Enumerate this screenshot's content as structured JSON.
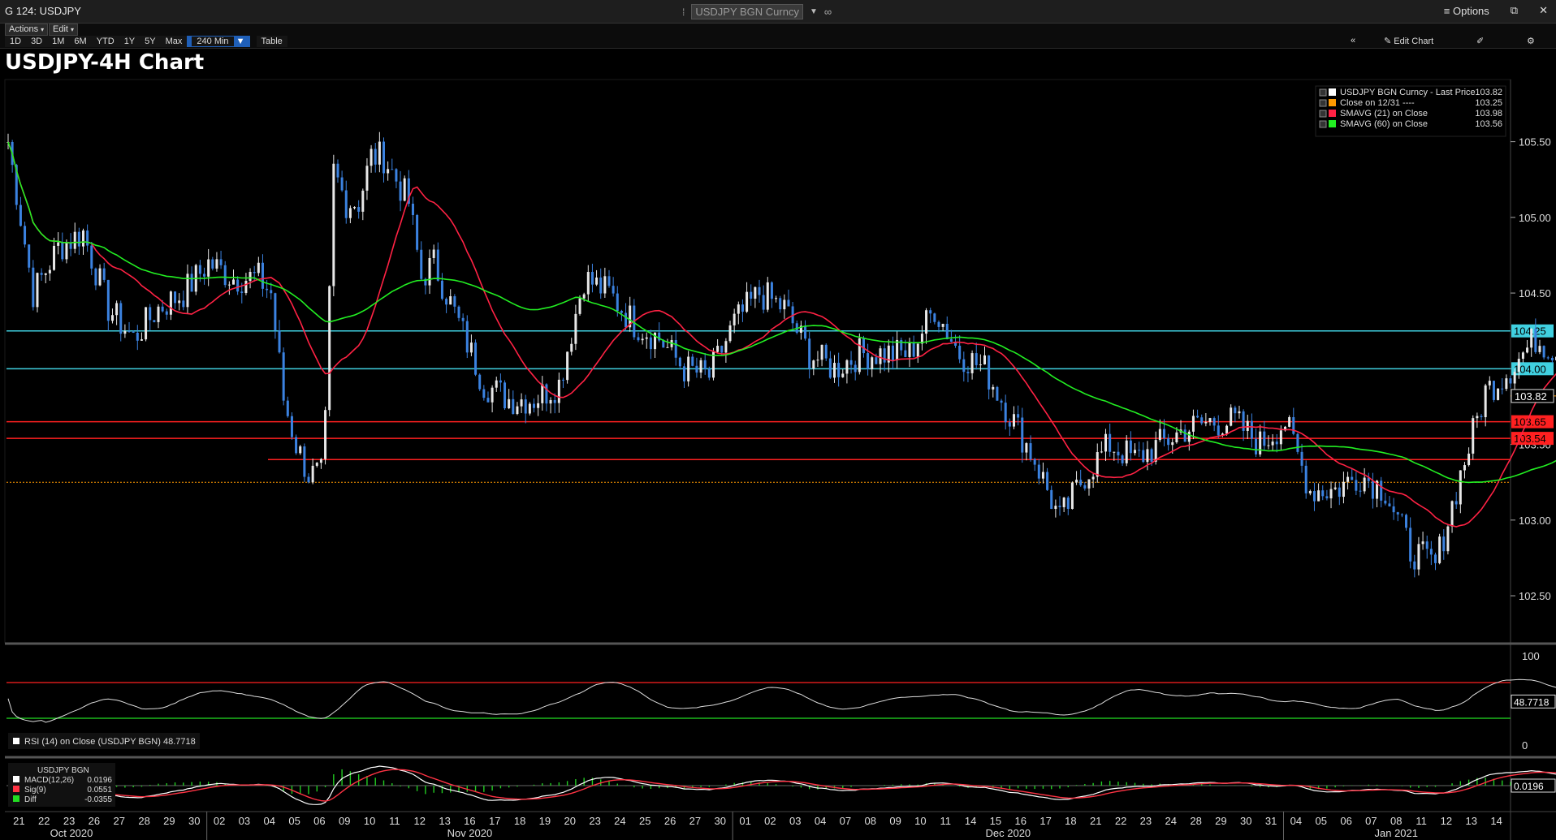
{
  "window": {
    "title": "G 124: USDJPY",
    "security": "USDJPY BGN Curncy",
    "options_label": "Options"
  },
  "toolbar": {
    "actions_label": "Actions",
    "edit_label": "Edit",
    "ranges": [
      "1D",
      "3D",
      "1M",
      "6M",
      "YTD",
      "1Y",
      "5Y",
      "Max",
      "240 Min"
    ],
    "selected_range": "240 Min",
    "table_label": "Table",
    "edit_chart_label": "Edit Chart"
  },
  "chart_title": "USDJPY-4H Chart",
  "legend": [
    {
      "label": "USDJPY BGN Curncy - Last Price",
      "value": "103.82",
      "color": "#ffffff"
    },
    {
      "label": "Close on 12/31 ----",
      "value": "103.25",
      "color": "#ff9900"
    },
    {
      "label": "SMAVG (21)  on Close",
      "value": "103.98",
      "color": "#ff2244"
    },
    {
      "label": "SMAVG (60)  on Close",
      "value": "103.56",
      "color": "#22ee22"
    }
  ],
  "chart_data": {
    "type": "candlestick",
    "ylim": [
      102.2,
      105.9
    ],
    "yticks": [
      "105.50",
      "105.00",
      "104.50",
      "104.00",
      "103.50",
      "103.00",
      "102.50"
    ],
    "x_days": [
      "21",
      "22",
      "23",
      "26",
      "27",
      "28",
      "29",
      "30",
      "02",
      "03",
      "04",
      "05",
      "06",
      "09",
      "10",
      "11",
      "12",
      "13",
      "16",
      "17",
      "18",
      "19",
      "20",
      "23",
      "24",
      "25",
      "26",
      "27",
      "30",
      "01",
      "02",
      "03",
      "04",
      "07",
      "08",
      "09",
      "10",
      "11",
      "14",
      "15",
      "16",
      "17",
      "18",
      "21",
      "22",
      "23",
      "24",
      "28",
      "29",
      "30",
      "31",
      "04",
      "05",
      "06",
      "07",
      "08",
      "11",
      "12",
      "13",
      "14"
    ],
    "months": [
      {
        "label": "Oct 2020",
        "first_day_index": 0
      },
      {
        "label": "Nov 2020",
        "first_day_index": 8
      },
      {
        "label": "Dec 2020",
        "first_day_index": 29
      },
      {
        "label": "Jan 2021",
        "first_day_index": 51
      }
    ],
    "levels": [
      {
        "value": 104.25,
        "label": "104.25",
        "color": "#40d0e0"
      },
      {
        "value": 104.0,
        "label": "104.00",
        "color": "#40d0e0"
      },
      {
        "value": 103.65,
        "label": "103.65",
        "color": "#ff2020"
      },
      {
        "value": 103.54,
        "label": "103.54",
        "color": "#ff2020"
      },
      {
        "value": 103.4,
        "label": "",
        "color": "#ff2020"
      }
    ],
    "last_price": {
      "value": 103.82,
      "label": "103.82"
    },
    "close_1231": 103.25,
    "price_anchors": [
      [
        0,
        105.5
      ],
      [
        1,
        104.5
      ],
      [
        2,
        104.8
      ],
      [
        3,
        104.9
      ],
      [
        4,
        104.4
      ],
      [
        5,
        104.2
      ],
      [
        6,
        104.4
      ],
      [
        7,
        104.5
      ],
      [
        8,
        104.7
      ],
      [
        9,
        104.6
      ],
      [
        10,
        104.6
      ],
      [
        10.5,
        104.5
      ],
      [
        11,
        103.8
      ],
      [
        11.5,
        103.5
      ],
      [
        12,
        103.3
      ],
      [
        12.6,
        103.3
      ],
      [
        13,
        105.3
      ],
      [
        13.5,
        105.1
      ],
      [
        14,
        105.1
      ],
      [
        14.5,
        105.4
      ],
      [
        15,
        105.4
      ],
      [
        16,
        105.1
      ],
      [
        16.5,
        104.6
      ],
      [
        17,
        104.7
      ],
      [
        18,
        104.3
      ],
      [
        19,
        103.9
      ],
      [
        20,
        103.8
      ],
      [
        21,
        103.8
      ],
      [
        22,
        103.9
      ],
      [
        23,
        104.6
      ],
      [
        24,
        104.5
      ],
      [
        25,
        104.3
      ],
      [
        26,
        104.2
      ],
      [
        27,
        104.0
      ],
      [
        28,
        103.95
      ],
      [
        29,
        104.3
      ],
      [
        30,
        104.5
      ],
      [
        31,
        104.4
      ],
      [
        32,
        104.1
      ],
      [
        33,
        104.0
      ],
      [
        34,
        104.1
      ],
      [
        35,
        104.1
      ],
      [
        36,
        104.1
      ],
      [
        37,
        104.4
      ],
      [
        38,
        104.1
      ],
      [
        39,
        104.0
      ],
      [
        40,
        103.7
      ],
      [
        41,
        103.4
      ],
      [
        42,
        103.0
      ],
      [
        43,
        103.3
      ],
      [
        44,
        103.5
      ],
      [
        45,
        103.4
      ],
      [
        46,
        103.5
      ],
      [
        47,
        103.6
      ],
      [
        48,
        103.65
      ],
      [
        49,
        103.65
      ],
      [
        50,
        103.5
      ],
      [
        51,
        103.65
      ],
      [
        52,
        103.2
      ],
      [
        53,
        103.2
      ],
      [
        54,
        103.3
      ],
      [
        55,
        103.2
      ],
      [
        56,
        102.8
      ],
      [
        57,
        102.7
      ],
      [
        58,
        103.3
      ],
      [
        59,
        103.85
      ],
      [
        60,
        104.0
      ],
      [
        61,
        104.2
      ],
      [
        62,
        104.1
      ],
      [
        63,
        103.7
      ],
      [
        64,
        103.9
      ],
      [
        65,
        104.1
      ],
      [
        66,
        103.82
      ]
    ],
    "sma21": {
      "name": "SMAVG (21)",
      "last": 103.98
    },
    "sma60": {
      "name": "SMAVG (60)",
      "last": 103.56
    },
    "rsi": {
      "label": "RSI (14)  on Close (USDJPY BGN)",
      "value": "48.7718",
      "ylim": [
        0,
        100
      ],
      "upper": 70,
      "lower": 30,
      "ticks": [
        "100",
        "0"
      ]
    },
    "macd": {
      "title": "USDJPY BGN",
      "macd_label": "MACD(12,26)",
      "macd": "0.0196",
      "sig_label": "Sig(9)",
      "sig": "0.0551",
      "diff_label": "Diff",
      "diff": "-0.0355",
      "axis_value": "0.0196"
    }
  }
}
